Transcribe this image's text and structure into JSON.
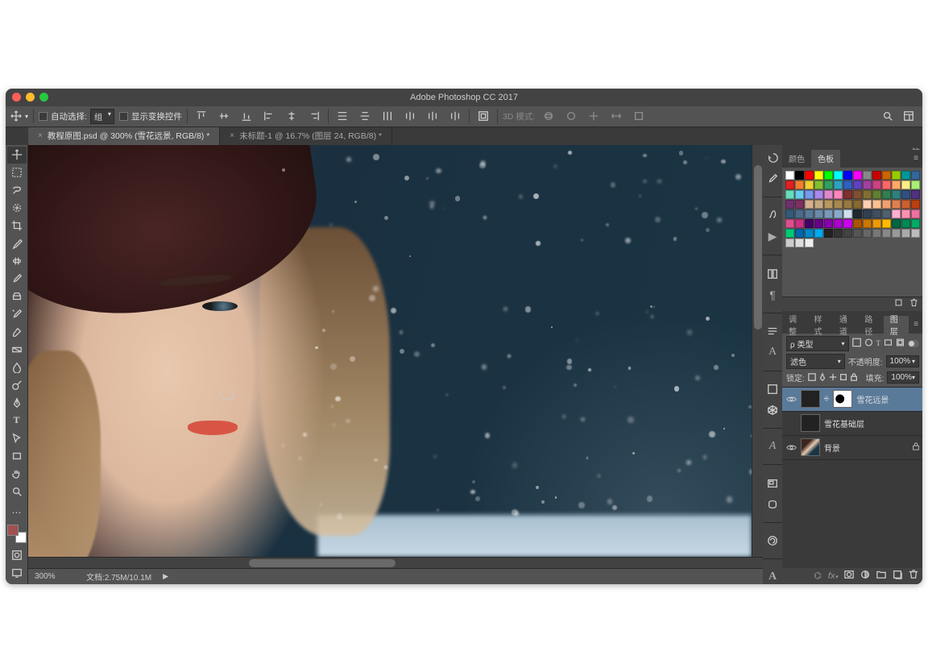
{
  "app": {
    "title": "Adobe Photoshop CC 2017"
  },
  "options": {
    "auto_select_label": "自动选择:",
    "auto_select_value": "组",
    "show_transform_label": "显示变换控件",
    "mode3d_label": "3D 模式:"
  },
  "tabs": [
    {
      "label": "教程原图.psd @ 300% (雪花远景, RGB/8) *",
      "active": true
    },
    {
      "label": "未标题-1 @ 16.7% (图层 24, RGB/8) *",
      "active": false
    }
  ],
  "tools": [
    "move",
    "marquee",
    "lasso",
    "quick-select",
    "crop",
    "eyedropper",
    "spot-heal",
    "brush",
    "clone",
    "history-brush",
    "eraser",
    "gradient",
    "blur",
    "dodge",
    "pen",
    "type",
    "path-select",
    "rectangle",
    "hand",
    "zoom"
  ],
  "status": {
    "zoom": "300%",
    "doc_info": "文档:2.75M/10.1M"
  },
  "panels": {
    "color_tabs": [
      "颜色",
      "色板"
    ],
    "color_active": 1,
    "swatches": [
      "#ffffff",
      "#000000",
      "#ff0000",
      "#ffff00",
      "#00ff00",
      "#00ffff",
      "#0000ff",
      "#ff00ff",
      "#888888",
      "#cc0000",
      "#cc6600",
      "#99cc00",
      "#009999",
      "#336699",
      "#e02020",
      "#f08030",
      "#f0d030",
      "#80c030",
      "#30a060",
      "#30a0c0",
      "#3060c0",
      "#6040c0",
      "#a040a0",
      "#d04080",
      "#ff6666",
      "#ffaa66",
      "#ffee88",
      "#aaee77",
      "#66ddbb",
      "#66ccee",
      "#7799ee",
      "#aa88ee",
      "#dd88cc",
      "#ff88bb",
      "#803030",
      "#805030",
      "#807030",
      "#608030",
      "#308050",
      "#308080",
      "#305080",
      "#503080",
      "#703070",
      "#803060",
      "#d8b090",
      "#c8a880",
      "#b89860",
      "#a88850",
      "#987840",
      "#886830",
      "#ffd0b0",
      "#ffc090",
      "#eea070",
      "#dd8050",
      "#cc6030",
      "#bb4010",
      "#335a7a",
      "#4a6a8a",
      "#5a7a9a",
      "#6a8aaa",
      "#7a9aba",
      "#8aaaca",
      "#d0e0f0",
      "#202830",
      "#304050",
      "#405060",
      "#506070",
      "#ffb0d0",
      "#ff90b0",
      "#ee70a0",
      "#dd5090",
      "#cc3080",
      "#440066",
      "#660088",
      "#8800aa",
      "#aa00cc",
      "#cc00ee",
      "#aa5500",
      "#cc7700",
      "#ee9900",
      "#ffbb00",
      "#006644",
      "#008855",
      "#00aa66",
      "#00cc77",
      "#0066aa",
      "#0088cc",
      "#00aaee",
      "#222222",
      "#333333",
      "#444444",
      "#555555",
      "#666666",
      "#777777",
      "#888888",
      "#999999",
      "#aaaaaa",
      "#bbbbbb",
      "#cccccc",
      "#dddddd",
      "#eeeeee"
    ],
    "layer_tabs": [
      "调整",
      "样式",
      "通道",
      "路径",
      "图层"
    ],
    "layer_tabs_active": 4,
    "kind_label": "类型",
    "blend_mode": "滤色",
    "opacity_label": "不透明度:",
    "opacity_value": "100%",
    "lock_label": "锁定:",
    "fill_label": "填充:",
    "fill_value": "100%",
    "layers": [
      {
        "name": "雪花远景",
        "visible": true,
        "selected": true,
        "has_mask": true,
        "locked": false
      },
      {
        "name": "雪花基础层",
        "visible": false,
        "selected": false,
        "has_mask": false,
        "locked": false
      },
      {
        "name": "背景",
        "visible": true,
        "selected": false,
        "has_mask": false,
        "locked": true
      }
    ]
  }
}
